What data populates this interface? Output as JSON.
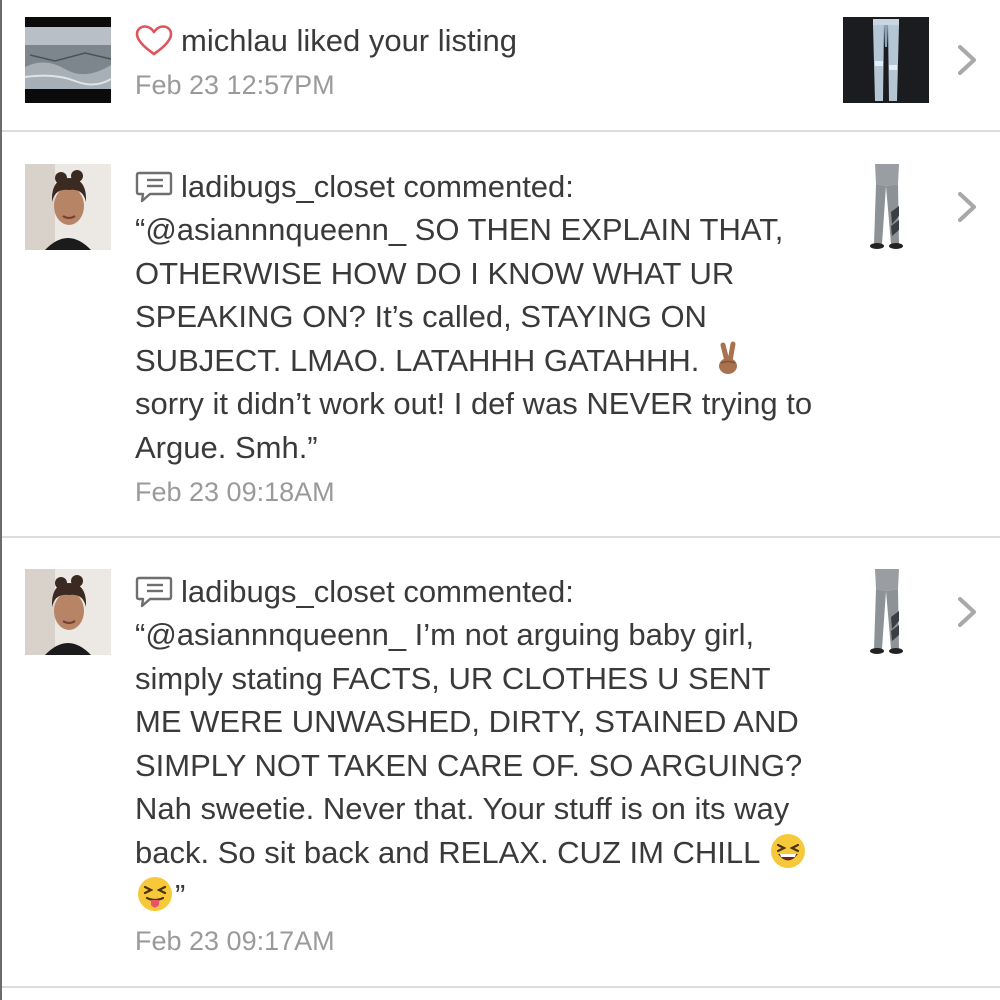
{
  "notifications": [
    {
      "type": "like",
      "icon": "heart-outline-icon",
      "accent": "#e0545c",
      "username": "michlau",
      "action": "liked your listing",
      "timestamp": "Feb 23 12:57PM"
    },
    {
      "type": "comment",
      "icon": "comment-bubble-icon",
      "username": "ladibugs_closet",
      "action": "commented:",
      "comment_parts": [
        "“@asiannnqueenn_ SO THEN EXPLAIN THAT, OTHERWISE HOW DO I KNOW WHAT UR SPEAKING ON? It’s called, STAYING ON SUBJECT. LMAO. LATAHHH GATAHHH. ",
        "sorry it didn’t work out! I def was NEVER trying to Argue. Smh.”"
      ],
      "emoji": [
        "victory-hand-emoji"
      ],
      "timestamp": "Feb 23 09:18AM"
    },
    {
      "type": "comment",
      "icon": "comment-bubble-icon",
      "username": "ladibugs_closet",
      "action": "commented:",
      "comment_parts": [
        "“@asiannnqueenn_ I’m not arguing baby girl, simply stating FACTS, UR CLOTHES U SENT ME WERE UNWASHED, DIRTY, STAINED AND SIMPLY NOT TAKEN CARE OF. SO ARGUING? Nah sweetie. Never that. Your stuff is on its way back. So sit back and RELAX. CUZ IM CHILL ",
        "”"
      ],
      "emoji": [
        "grinning-squinting-face-emoji",
        "squinting-face-with-tongue-emoji"
      ],
      "timestamp": "Feb 23 09:17AM"
    }
  ]
}
